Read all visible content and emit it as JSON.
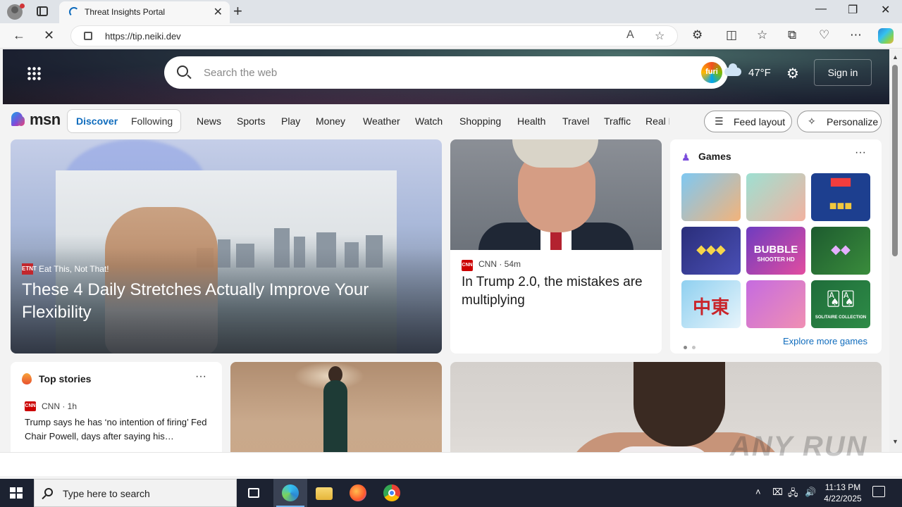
{
  "browser": {
    "tab_title": "Threat Insights Portal",
    "url": "https://tip.neiki.dev"
  },
  "msn": {
    "search_placeholder": "Search the web",
    "copilot_badge": "furi",
    "weather_temp": "47°F",
    "sign_in": "Sign in",
    "logo_text": "msn",
    "discover": "Discover",
    "following": "Following",
    "categories": [
      "News",
      "Sports",
      "Play",
      "Money",
      "Weather",
      "Watch",
      "Shopping",
      "Health",
      "Travel",
      "Traffic",
      "Real E"
    ],
    "feed_layout": "Feed layout",
    "personalize": "Personalize"
  },
  "hero": {
    "source_logo": "ETNT",
    "source": "Eat This, Not That!",
    "headline": "These 4 Daily Stretches Actually Improve Your Flexibility"
  },
  "trump_story": {
    "source_logo": "CNN",
    "source": "CNN · 54m",
    "headline": "In Trump 2.0, the mistakes are multiplying"
  },
  "games": {
    "title": "Games",
    "more": "···",
    "tile_bubble": "BUBBLE",
    "tile_shooter": "SHOOTER HD",
    "tile_mahjong": "中東",
    "tile_solitaire": "SOLITAIRE COLLECTION",
    "explore": "Explore more games"
  },
  "top_stories": {
    "title": "Top stories",
    "more": "···",
    "source_logo": "CNN",
    "source": "CNN · 1h",
    "story": "Trump says he has ‘no intention of firing’ Fed Chair Powell, days after saying his…"
  },
  "watermark": "ANY RUN",
  "taskbar": {
    "search_placeholder": "Type here to search",
    "time": "11:13 PM",
    "date": "4/22/2025"
  }
}
